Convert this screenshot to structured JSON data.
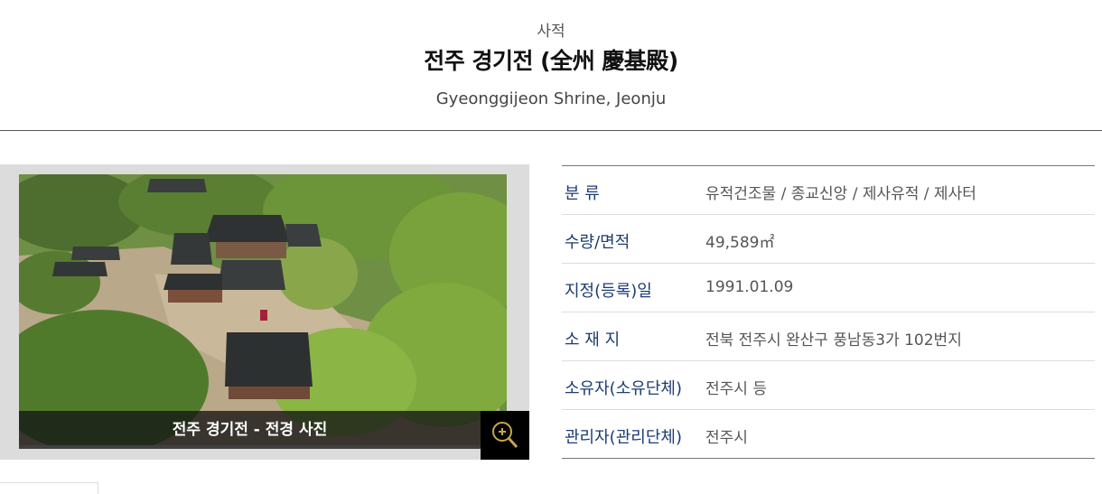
{
  "header": {
    "category": "사적",
    "title": "전주 경기전 (全州 慶基殿)",
    "subtitle": "Gyeonggijeon Shrine, Jeonju"
  },
  "photo": {
    "caption": "전주 경기전 - 전경 사진",
    "zoom_icon": "zoom-in-icon"
  },
  "info_rows": [
    {
      "label": "분 류",
      "value": "유적건조물 / 종교신앙 / 제사유적 / 제사터"
    },
    {
      "label": "수량/면적",
      "value": "49,589㎡"
    },
    {
      "label": "지정(등록)일",
      "value": "1991.01.09"
    },
    {
      "label": "소 재 지",
      "value": "전북 전주시 완산구 풍남동3가 102번지"
    },
    {
      "label": "소유자(소유단체)",
      "value": "전주시 등"
    },
    {
      "label": "관리자(관리단체)",
      "value": "전주시"
    }
  ],
  "colors": {
    "label_text": "#1c3d73",
    "zoom_icon": "#c8a64b"
  }
}
